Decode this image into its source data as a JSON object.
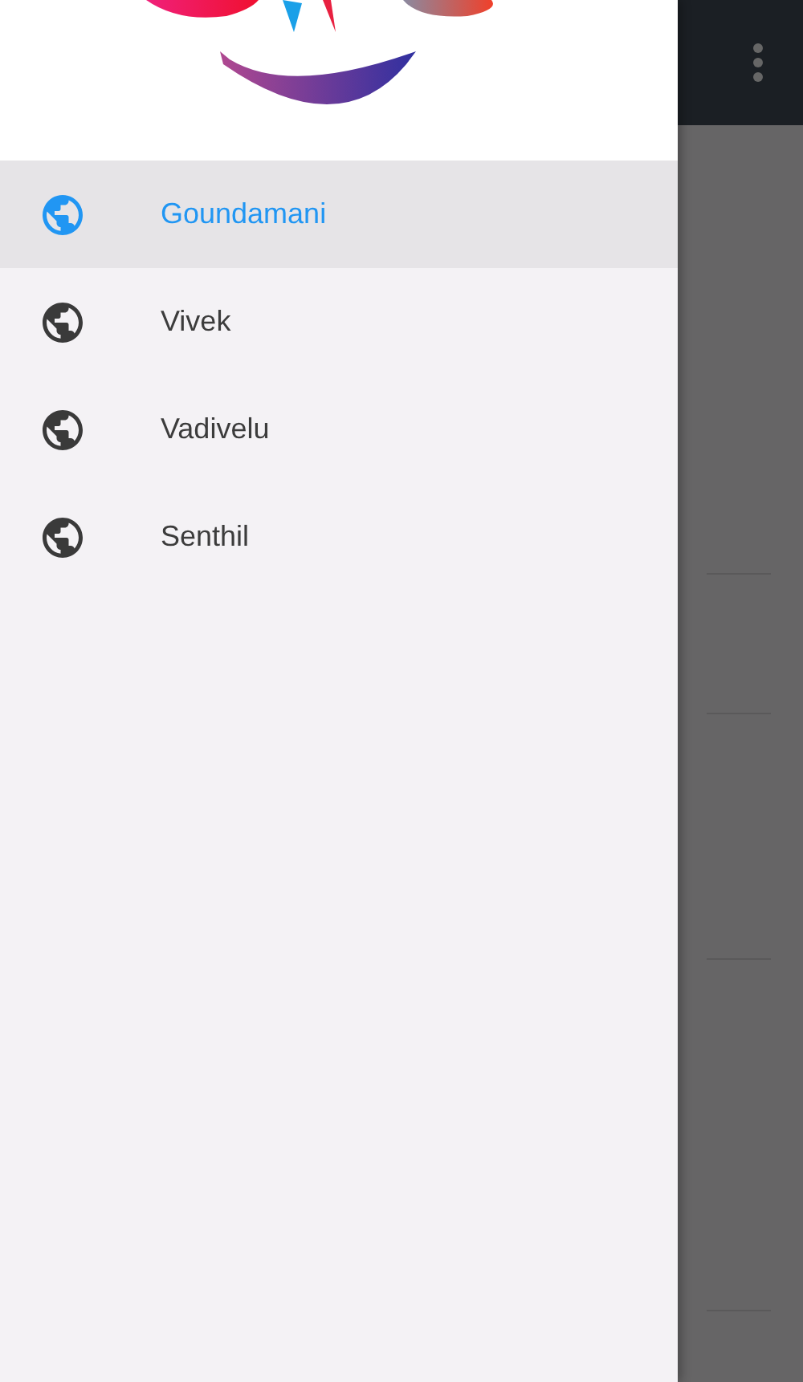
{
  "drawer": {
    "items": [
      {
        "label": "Goundamani",
        "selected": true
      },
      {
        "label": "Vivek",
        "selected": false
      },
      {
        "label": "Vadivelu",
        "selected": false
      },
      {
        "label": "Senthil",
        "selected": false
      }
    ]
  }
}
